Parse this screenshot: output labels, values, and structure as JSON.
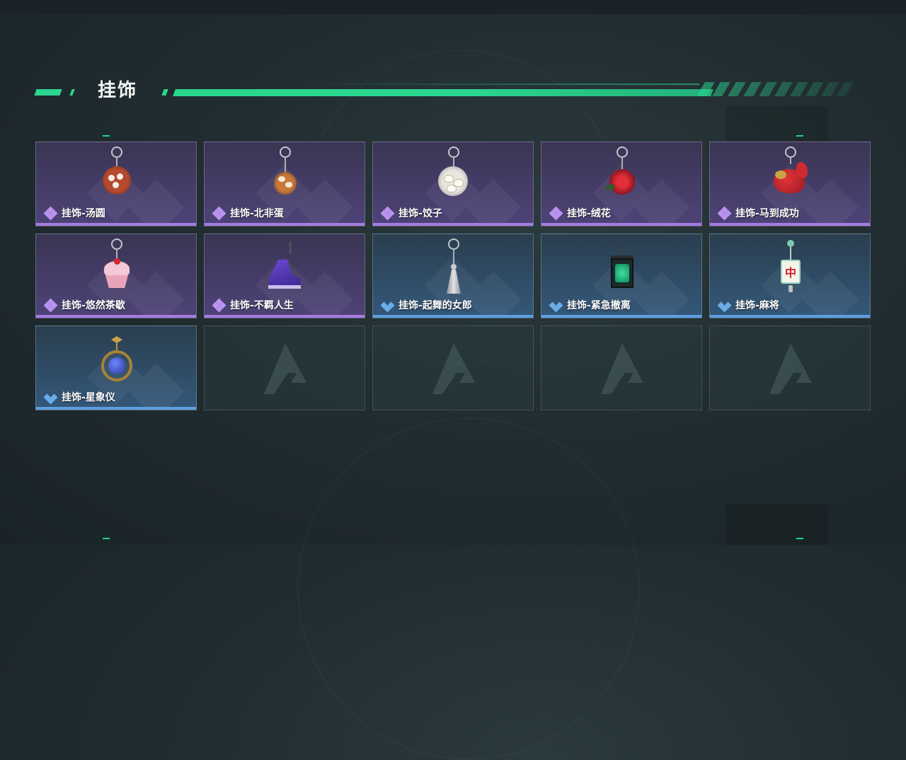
{
  "page": {
    "title": "挂饰"
  },
  "colors": {
    "accent": "#2bd68f",
    "epic": "#a47ce0",
    "rare": "#5d9fe0"
  },
  "cards": [
    {
      "name": "挂饰-汤圆",
      "rarity": "epic",
      "icon": "tangyuan-charm-icon"
    },
    {
      "name": "挂饰-北非蛋",
      "rarity": "epic",
      "icon": "shakshuka-charm-icon"
    },
    {
      "name": "挂饰-饺子",
      "rarity": "epic",
      "icon": "dumpling-charm-icon"
    },
    {
      "name": "挂饰-绒花",
      "rarity": "epic",
      "icon": "velvet-flower-charm-icon"
    },
    {
      "name": "挂饰-马到成功",
      "rarity": "epic",
      "icon": "red-horse-charm-icon"
    },
    {
      "name": "挂饰-悠然茶歇",
      "rarity": "epic",
      "icon": "cupcake-charm-icon"
    },
    {
      "name": "挂饰-不羁人生",
      "rarity": "epic",
      "icon": "sneaker-charm-icon"
    },
    {
      "name": "挂饰-起舞的女郎",
      "rarity": "rare",
      "icon": "dancer-charm-icon"
    },
    {
      "name": "挂饰-紧急撤离",
      "rarity": "rare",
      "icon": "exit-sign-charm-icon"
    },
    {
      "name": "挂饰-麻将",
      "rarity": "rare",
      "icon": "mahjong-tile-charm-icon"
    },
    {
      "name": "挂饰-星象仪",
      "rarity": "rare",
      "icon": "astrolabe-charm-icon"
    }
  ],
  "mahjong_glyph": "中"
}
